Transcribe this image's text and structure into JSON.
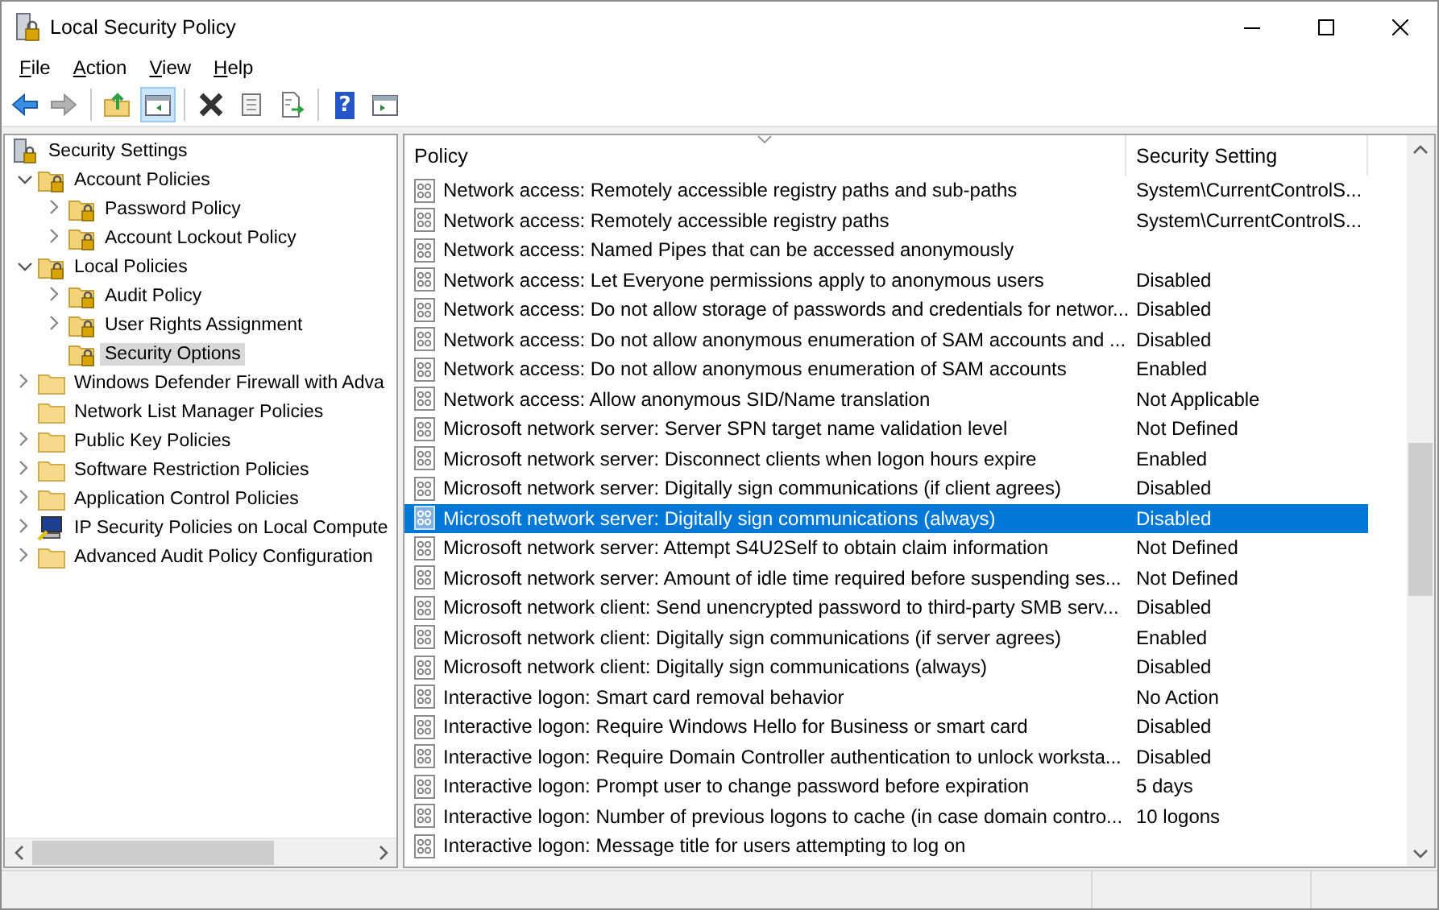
{
  "window": {
    "title": "Local Security Policy"
  },
  "menu": [
    {
      "label": "File"
    },
    {
      "label": "Action"
    },
    {
      "label": "View"
    },
    {
      "label": "Help"
    }
  ],
  "toolbar": {
    "groups": [
      {
        "buttons": [
          {
            "kind": "back",
            "disabled": false,
            "pressed": false
          },
          {
            "kind": "forward",
            "disabled": true,
            "pressed": false
          }
        ]
      },
      {
        "buttons": [
          {
            "kind": "up",
            "disabled": false,
            "pressed": false
          },
          {
            "kind": "console-tree",
            "disabled": false,
            "pressed": true
          }
        ]
      },
      {
        "buttons": [
          {
            "kind": "delete",
            "disabled": false,
            "pressed": false
          },
          {
            "kind": "properties",
            "disabled": false,
            "pressed": false
          },
          {
            "kind": "export",
            "disabled": false,
            "pressed": false
          }
        ]
      },
      {
        "buttons": [
          {
            "kind": "help",
            "label": "?",
            "disabled": false,
            "pressed": false
          },
          {
            "kind": "action-pane",
            "disabled": false,
            "pressed": false
          }
        ]
      }
    ]
  },
  "tree": [
    {
      "label": "Security Settings",
      "kind": "root",
      "selected": false,
      "children": [
        {
          "label": "Account Policies",
          "kind": "locked-folder",
          "expanded": true,
          "selected": false,
          "children": [
            {
              "label": "Password Policy",
              "kind": "locked-folder",
              "expanded": false,
              "selected": false
            },
            {
              "label": "Account Lockout Policy",
              "kind": "locked-folder",
              "expanded": false,
              "selected": false
            }
          ]
        },
        {
          "label": "Local Policies",
          "kind": "locked-folder",
          "expanded": true,
          "selected": false,
          "children": [
            {
              "label": "Audit Policy",
              "kind": "locked-folder",
              "expanded": false,
              "selected": false
            },
            {
              "label": "User Rights Assignment",
              "kind": "locked-folder",
              "expanded": false,
              "selected": false
            },
            {
              "label": "Security Options",
              "kind": "locked-folder",
              "selected": true
            }
          ]
        },
        {
          "label": "Windows Defender Firewall with Adva",
          "kind": "folder",
          "expanded": false,
          "selected": false
        },
        {
          "label": "Network List Manager Policies",
          "kind": "folder",
          "selected": false
        },
        {
          "label": "Public Key Policies",
          "kind": "folder",
          "expanded": false,
          "selected": false
        },
        {
          "label": "Software Restriction Policies",
          "kind": "folder",
          "expanded": false,
          "selected": false
        },
        {
          "label": "Application Control Policies",
          "kind": "folder",
          "expanded": false,
          "selected": false
        },
        {
          "label": "IP Security Policies on Local Compute",
          "kind": "computer",
          "expanded": false,
          "selected": false
        },
        {
          "label": "Advanced Audit Policy Configuration",
          "kind": "folder",
          "expanded": false,
          "selected": false
        }
      ]
    }
  ],
  "table": {
    "columns": [
      "Policy",
      "Security Setting"
    ],
    "rows": [
      {
        "policy": "Network access: Remotely accessible registry paths and sub-paths",
        "setting": "System\\CurrentControlS...",
        "selected": false
      },
      {
        "policy": "Network access: Remotely accessible registry paths",
        "setting": "System\\CurrentControlS...",
        "selected": false
      },
      {
        "policy": "Network access: Named Pipes that can be accessed anonymously",
        "selected": false
      },
      {
        "policy": "Network access: Let Everyone permissions apply to anonymous users",
        "setting": "Disabled",
        "selected": false
      },
      {
        "policy": "Network access: Do not allow storage of passwords and credentials for networ...",
        "setting": "Disabled",
        "selected": false
      },
      {
        "policy": "Network access: Do not allow anonymous enumeration of SAM accounts and ...",
        "setting": "Disabled",
        "selected": false
      },
      {
        "policy": "Network access: Do not allow anonymous enumeration of SAM accounts",
        "setting": "Enabled",
        "selected": false
      },
      {
        "policy": "Network access: Allow anonymous SID/Name translation",
        "setting": "Not Applicable",
        "selected": false
      },
      {
        "policy": "Microsoft network server: Server SPN target name validation level",
        "setting": "Not Defined",
        "selected": false
      },
      {
        "policy": "Microsoft network server: Disconnect clients when logon hours expire",
        "setting": "Enabled",
        "selected": false
      },
      {
        "policy": "Microsoft network server: Digitally sign communications (if client agrees)",
        "setting": "Disabled",
        "selected": false
      },
      {
        "policy": "Microsoft network server: Digitally sign communications (always)",
        "setting": "Disabled",
        "selected": true
      },
      {
        "policy": "Microsoft network server: Attempt S4U2Self to obtain claim information",
        "setting": "Not Defined",
        "selected": false
      },
      {
        "policy": "Microsoft network server: Amount of idle time required before suspending ses...",
        "setting": "Not Defined",
        "selected": false
      },
      {
        "policy": "Microsoft network client: Send unencrypted password to third-party SMB serv...",
        "setting": "Disabled",
        "selected": false
      },
      {
        "policy": "Microsoft network client: Digitally sign communications (if server agrees)",
        "setting": "Enabled",
        "selected": false
      },
      {
        "policy": "Microsoft network client: Digitally sign communications (always)",
        "setting": "Disabled",
        "selected": false
      },
      {
        "policy": "Interactive logon: Smart card removal behavior",
        "setting": "No Action",
        "selected": false
      },
      {
        "policy": "Interactive logon: Require Windows Hello for Business or smart card",
        "setting": "Disabled",
        "selected": false
      },
      {
        "policy": "Interactive logon: Require Domain Controller authentication to unlock worksta...",
        "setting": "Disabled",
        "selected": false
      },
      {
        "policy": "Interactive logon: Prompt user to change password before expiration",
        "setting": "5 days",
        "selected": false
      },
      {
        "policy": "Interactive logon: Number of previous logons to cache (in case domain contro...",
        "setting": "10 logons",
        "selected": false
      },
      {
        "policy": "Interactive logon: Message title for users attempting to log on",
        "selected": false
      }
    ]
  }
}
